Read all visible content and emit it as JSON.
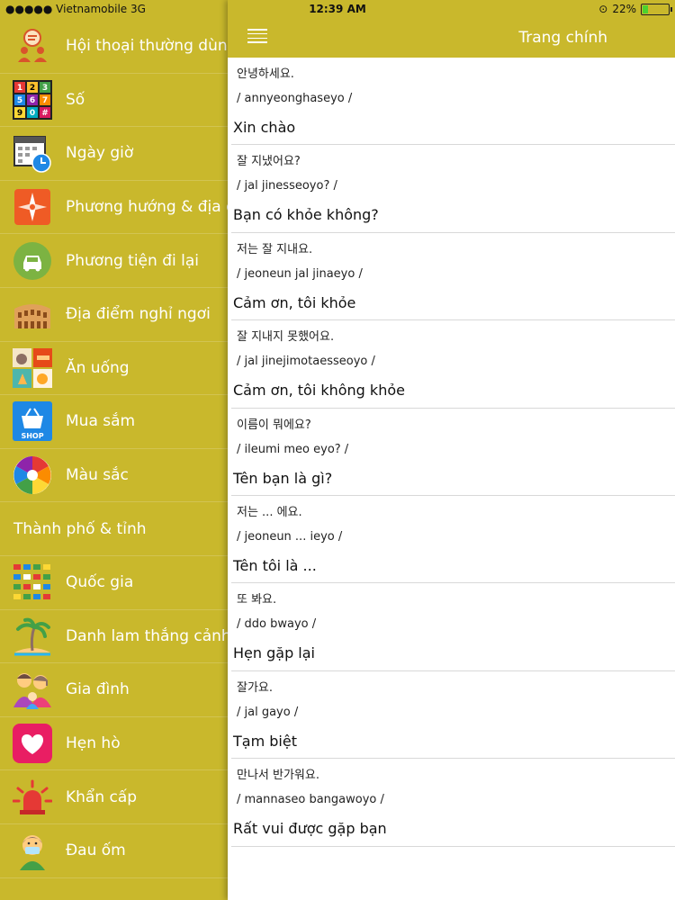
{
  "status": {
    "carrier": "●●●●● Vietnamobile  3G",
    "time": "12:39 AM",
    "battery": "22%",
    "battery_level": 0.22
  },
  "header": {
    "title": "Trang chính"
  },
  "sidebar": {
    "items": [
      {
        "label": "Hội thoại thường dùng",
        "icon": "conversation-icon"
      },
      {
        "label": "Số",
        "icon": "numbers-icon"
      },
      {
        "label": "Ngày giờ",
        "icon": "calendar-clock-icon"
      },
      {
        "label": "Phương hướng & địa điểm",
        "icon": "compass-icon"
      },
      {
        "label": "Phương tiện đi lại",
        "icon": "car-icon"
      },
      {
        "label": "Địa điểm nghỉ ngơi",
        "icon": "colosseum-icon"
      },
      {
        "label": "Ăn uống",
        "icon": "food-icon"
      },
      {
        "label": "Mua sắm",
        "icon": "shop-basket-icon"
      },
      {
        "label": "Màu sắc",
        "icon": "color-wheel-icon"
      }
    ],
    "section": "Thành phố & tỉnh",
    "items2": [
      {
        "label": "Quốc gia",
        "icon": "flags-icon"
      },
      {
        "label": "Danh lam thắng cảnh",
        "icon": "palm-island-icon"
      },
      {
        "label": "Gia đình",
        "icon": "family-icon"
      },
      {
        "label": "Hẹn hò",
        "icon": "heart-icon"
      },
      {
        "label": "Khẩn cấp",
        "icon": "siren-icon"
      },
      {
        "label": "Đau ốm",
        "icon": "sick-person-icon"
      }
    ]
  },
  "phrases": [
    {
      "ko": "안녕하세요.",
      "rom": "/ annyeonghaseyo /",
      "vi": "Xin chào"
    },
    {
      "ko": "잘 지냈어요?",
      "rom": "/ jal jinesseoyo? /",
      "vi": "Bạn có khỏe không?"
    },
    {
      "ko": "저는 잘 지내요.",
      "rom": "/ jeoneun jal jinaeyo /",
      "vi": "Cảm ơn, tôi khỏe"
    },
    {
      "ko": "잘 지내지 못했어요.",
      "rom": "/ jal jinejimotaesseoyo /",
      "vi": "Cảm ơn, tôi không khỏe"
    },
    {
      "ko": "이름이 뭐에요?",
      "rom": "/ ileumi meo eyo? /",
      "vi": "Tên bạn là gì?"
    },
    {
      "ko": "저는 ... 에요.",
      "rom": "/ jeoneun ... ieyo /",
      "vi": "Tên tôi là ..."
    },
    {
      "ko": "또 봐요.",
      "rom": "/ ddo bwayo /",
      "vi": "Hẹn gặp lại"
    },
    {
      "ko": "잘가요.",
      "rom": "/ jal gayo /",
      "vi": "Tạm biệt"
    },
    {
      "ko": "만나서 반가워요.",
      "rom": "/ mannaseo bangawoyo /",
      "vi": "Rất vui được gặp bạn"
    }
  ]
}
